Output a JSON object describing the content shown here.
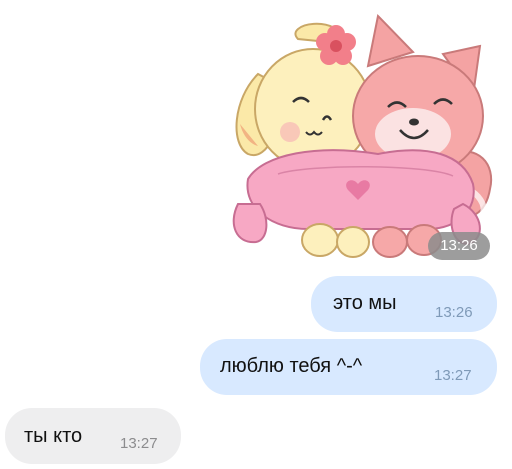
{
  "sticker": {
    "name": "fox-and-bunny-hug-sticker",
    "time": "13:26"
  },
  "messages": [
    {
      "text": "это мы",
      "time": "13:26",
      "direction": "outgoing"
    },
    {
      "text": "люблю тебя ^-^",
      "time": "13:27",
      "direction": "outgoing"
    },
    {
      "text": "ты кто",
      "time": "13:27",
      "direction": "incoming"
    }
  ],
  "colors": {
    "outgoing_bubble": "#d8e9ff",
    "incoming_bubble": "#eeeeef",
    "sticker_time_pill": "#8c8c8c"
  }
}
